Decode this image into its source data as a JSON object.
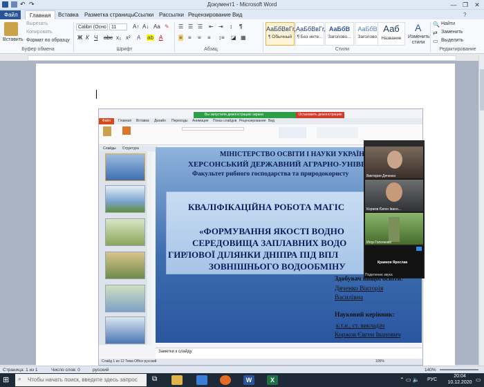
{
  "window": {
    "title": "Документ1 - Microsoft Word",
    "controls": {
      "minimize": "—",
      "maximize": "❐",
      "close": "✕"
    }
  },
  "tabs": [
    {
      "label": "Файл"
    },
    {
      "label": "Главная"
    },
    {
      "label": "Вставка"
    },
    {
      "label": "Разметка страницы"
    },
    {
      "label": "Ссылки"
    },
    {
      "label": "Рассылки"
    },
    {
      "label": "Рецензирование"
    },
    {
      "label": "Вид"
    }
  ],
  "ribbon": {
    "clipboard": {
      "paste": "Вставить",
      "cut": "Вырезать",
      "copy": "Копировать",
      "format_painter": "Формат по образцу",
      "group": "Буфер обмена"
    },
    "font": {
      "name": "Calibri (Осно",
      "size": "11",
      "group": "Шрифт",
      "bold": "Ж",
      "italic": "К",
      "underline": "Ч"
    },
    "paragraph": {
      "group": "Абзац"
    },
    "styles": {
      "group": "Стили",
      "items": [
        {
          "sample": "АаБбВвГг,",
          "name": "¶ Обычный"
        },
        {
          "sample": "АаБбВвГг,",
          "name": "¶ Без инте..."
        },
        {
          "sample": "АаБбВ",
          "name": "Заголово..."
        },
        {
          "sample": "АаБбВв",
          "name": "Заголово..."
        },
        {
          "sample": "Ааб",
          "name": "Название"
        }
      ],
      "change": "Изменить стили"
    },
    "editing": {
      "group": "Редактирование",
      "find": "Найти",
      "replace": "Заменить",
      "select": "Выделить"
    }
  },
  "embedded": {
    "share_bar": "Вы запустили демонстрацию экрана",
    "stop_share": "Остановить демонстрацию",
    "pp_tabs": [
      "Файл",
      "Главная",
      "Вставка",
      "Дизайн",
      "Переходы",
      "Анимация",
      "Показ слайдов",
      "Рецензирование",
      "Вид"
    ],
    "panel_tabs": [
      "Слайды",
      "Структура"
    ],
    "slide": {
      "line1": "МІНІСТЕРСТВО ОСВІТИ І НАУКИ УКРАЇН",
      "line2": "ХЕРСОНСЬКИЙ ДЕРЖАВНИЙ АГРАРНО-УНІВЕРС",
      "line3": "Факультет рибного господарства та природокористу",
      "title": "КВАЛІФІКАЦІЙНА РОБОТА МАГІС",
      "subtitle1": "«ФОРМУВАННЯ ЯКОСТІ ВОДНО",
      "subtitle2": "СЕРЕДОВИЩА ЗАПЛАВНИХ ВОДО",
      "subtitle3": "ГИРЛОВОЇ ДІЛЯНКИ ДНІПРА ПІД ВПЛ",
      "subtitle4": "ЗОВНІШНЬОГО ВОДООБМІНУ",
      "applicant_label": "Здобувач вищої освіти:",
      "applicant1": "Дяченко Вікторія",
      "applicant2": "Василівна",
      "supervisor_label": "Науковий керівник:",
      "supervisor_role": "к.т.н.,  ст. викладач",
      "supervisor_name": "Коржов Євген Іванович"
    },
    "notes": "Заметки к слайду",
    "status": "Слайд 1 из 12   Тема Office   русский",
    "zoom": "105%",
    "participants": [
      {
        "name": "Виктория Дяченко"
      },
      {
        "name": "Коржов Євген Івано..."
      },
      {
        "name": "Игор Голоченко"
      },
      {
        "name": "Кравков Ярослав"
      }
    ],
    "sharing_label": "Поделение звука"
  },
  "statusbar": {
    "page": "Страница: 1 из 1",
    "words": "Число слов: 0",
    "lang": "русский",
    "zoom": "140%"
  },
  "taskbar": {
    "search_placeholder": "Чтобы начать поиск, введите здесь запрос",
    "lang": "РУС",
    "time": "20:04",
    "date": "10.12.2020"
  },
  "colors": {
    "word_blue": "#2a5699",
    "share_green": "#2c9e45",
    "stop_red": "#d33a2c",
    "slide_blue": "#3d6db0"
  }
}
